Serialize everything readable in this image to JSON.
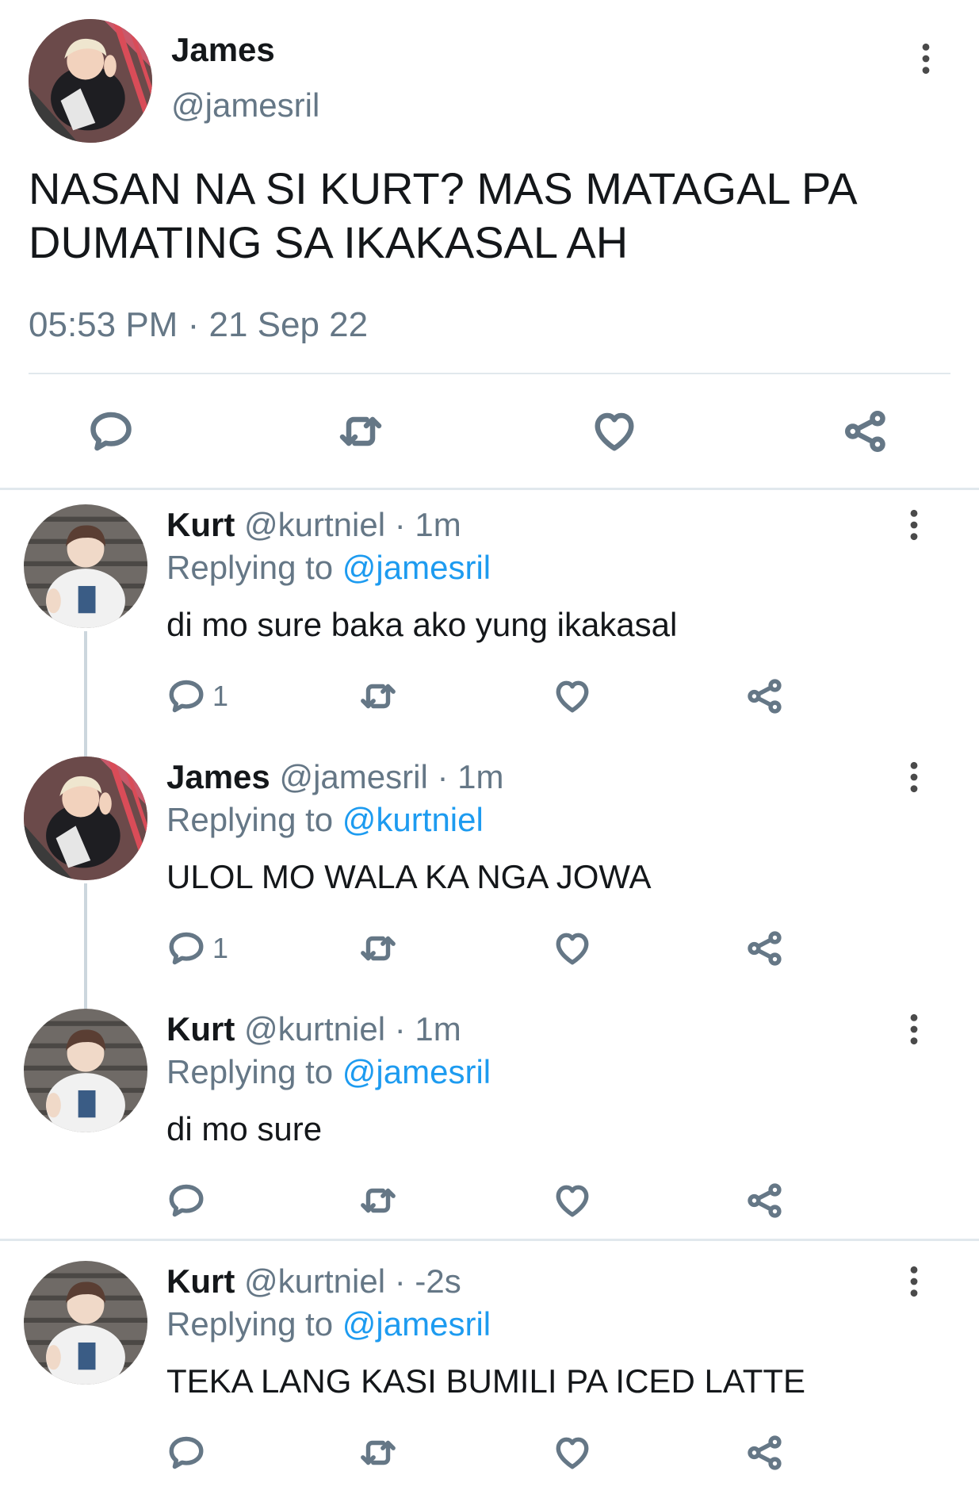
{
  "main_tweet": {
    "name": "James",
    "handle": "@jamesril",
    "text": "NASAN NA SI KURT? MAS MATAGAL PA DUMATING SA IKAKASAL AH",
    "time": "05:53 PM",
    "date": "21 Sep 22",
    "date_separator": "·",
    "actions": [
      "reply-icon",
      "retweet-icon",
      "like-icon",
      "share-icon"
    ]
  },
  "replies": [
    {
      "name": "Kurt",
      "handle": "@kurtniel",
      "dot": "·",
      "time": "1m",
      "replying_prefix": "Replying to ",
      "replying_to": "@jamesril",
      "text": "di mo sure baka ako yung ikakasal",
      "reply_count": "1"
    },
    {
      "name": "James",
      "handle": "@jamesril",
      "dot": "·",
      "time": "1m",
      "replying_prefix": "Replying to ",
      "replying_to": "@kurtniel",
      "text": "ULOL MO WALA KA NGA JOWA",
      "reply_count": "1"
    },
    {
      "name": "Kurt",
      "handle": "@kurtniel",
      "dot": "·",
      "time": "1m",
      "replying_prefix": "Replying to ",
      "replying_to": "@jamesril",
      "text": "di mo sure",
      "reply_count": ""
    },
    {
      "name": "Kurt",
      "handle": "@kurtniel",
      "dot": "·",
      "time": "-2s",
      "replying_prefix": "Replying to ",
      "replying_to": "@jamesril",
      "text": "TEKA LANG KASI BUMILI PA ICED LATTE",
      "reply_count": ""
    }
  ],
  "colors": {
    "text": "#14171a",
    "muted": "#657786",
    "link": "#1d9bf0",
    "divider": "#e1e8ed",
    "thread_line": "#ccd6dd"
  }
}
